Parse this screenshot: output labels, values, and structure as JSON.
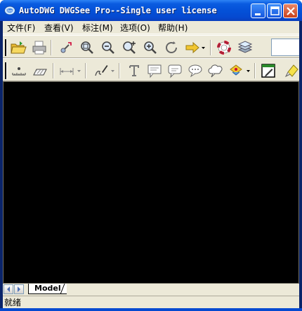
{
  "window": {
    "title": "AutoDWG DWGSee Pro--Single user license"
  },
  "menubar": {
    "items": [
      {
        "label": "文件(F)"
      },
      {
        "label": "查看(V)"
      },
      {
        "label": "标注(M)"
      },
      {
        "label": "选项(O)"
      },
      {
        "label": "帮助(H)"
      }
    ]
  },
  "toolbar1": {
    "icons": [
      "open-folder-icon",
      "print-icon",
      "pan-icon",
      "zoom-window-icon",
      "zoom-out-icon",
      "zoom-in-icon",
      "zoom-extents-icon",
      "redraw-icon",
      "forward-arrow-icon",
      "help-lifebuoy-icon",
      "layers-icon"
    ],
    "input_value": ""
  },
  "toolbar2": {
    "icons": [
      "measure-point-icon",
      "measure-area-icon",
      "dimension-icon",
      "pen-icon",
      "text-icon",
      "callout-icon",
      "comment-bubble-icon",
      "speech-bubble-icon",
      "cloud-bubble-icon",
      "stamp-icon",
      "edit-icon",
      "highlighter-icon"
    ]
  },
  "tabs": {
    "items": [
      {
        "label": "Model"
      }
    ]
  },
  "status": {
    "text": "就绪"
  },
  "colors": {
    "titlebar": "#0451d8",
    "chrome": "#ece9d8",
    "canvas": "#000000"
  }
}
